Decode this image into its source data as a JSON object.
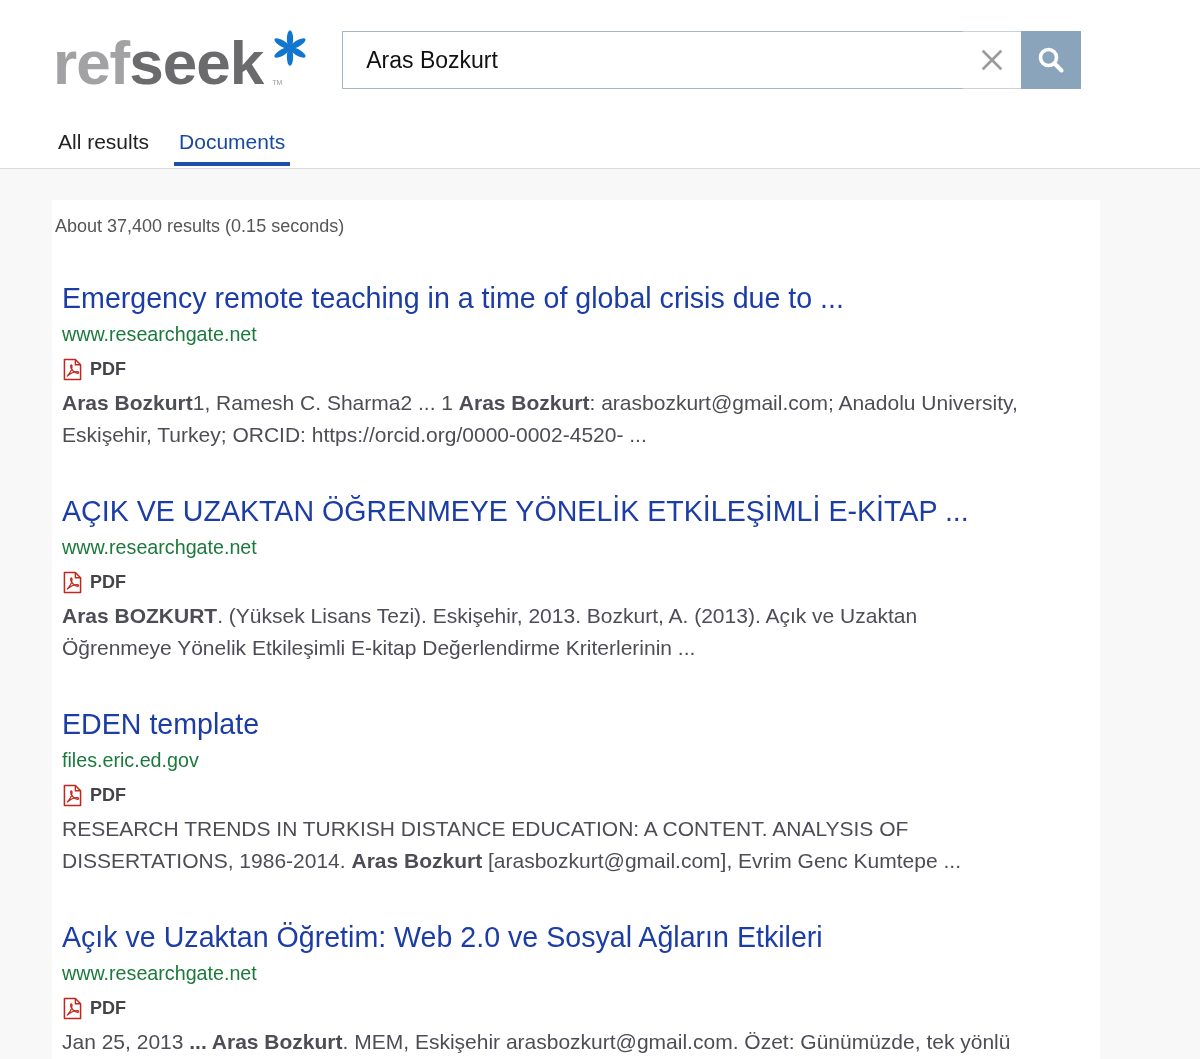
{
  "logo": {
    "wordmark_parts": [
      "ref",
      "seek"
    ],
    "trademark": "TM"
  },
  "search": {
    "value": "Aras Bozkurt"
  },
  "tabs": [
    {
      "label": "All results",
      "selected": false
    },
    {
      "label": "Documents",
      "selected": true
    }
  ],
  "result_stats": "About 37,400 results (0.15 seconds)",
  "results": [
    {
      "title": "Emergency remote teaching in a time of global crisis due to ...",
      "url": "www.researchgate.net",
      "file_type": "PDF",
      "snippet_lines": [
        "**Aras Bozkurt**1, Ramesh C. Sharma2 ... 1 **Aras Bozkurt**: arasbozkurt@gmail.com; Anadolu University,",
        "Eskişehir, Turkey; ORCID: https://orcid.org/0000-0002-4520- ..."
      ]
    },
    {
      "title": "AÇIK VE UZAKTAN ÖĞRENMEYE YÖNELİK ETKİLEŞİMLİ E-KİTAP ...",
      "url": "www.researchgate.net",
      "file_type": "PDF",
      "snippet_lines": [
        "**Aras BOZKURT**. (Yüksek Lisans Tezi). Eskişehir, 2013. Bozkurt, A. (2013). Açık ve Uzaktan",
        "Öğrenmeye Yönelik Etkileşimli E-kitap Değerlendirme Kriterlerinin ..."
      ]
    },
    {
      "title": "EDEN template",
      "url": "files.eric.ed.gov",
      "file_type": "PDF",
      "snippet_lines": [
        "RESEARCH TRENDS IN TURKISH DISTANCE EDUCATION: A CONTENT. ANALYSIS OF",
        "DISSERTATIONS, 1986-2014. **Aras Bozkurt** [arasbozkurt@gmail.com], Evrim Genc Kumtepe ..."
      ]
    },
    {
      "title": "Açık ve Uzaktan Öğretim: Web 2.0 ve Sosyal Ağların Etkileri",
      "url": "www.researchgate.net",
      "file_type": "PDF",
      "snippet_lines": [
        "Jan 25, 2013 **... Aras Bozkurt**. MEM, Eskişehir arasbozkurt@gmail.com. Özet: Günümüzde, tek yönlü"
      ]
    }
  ]
}
